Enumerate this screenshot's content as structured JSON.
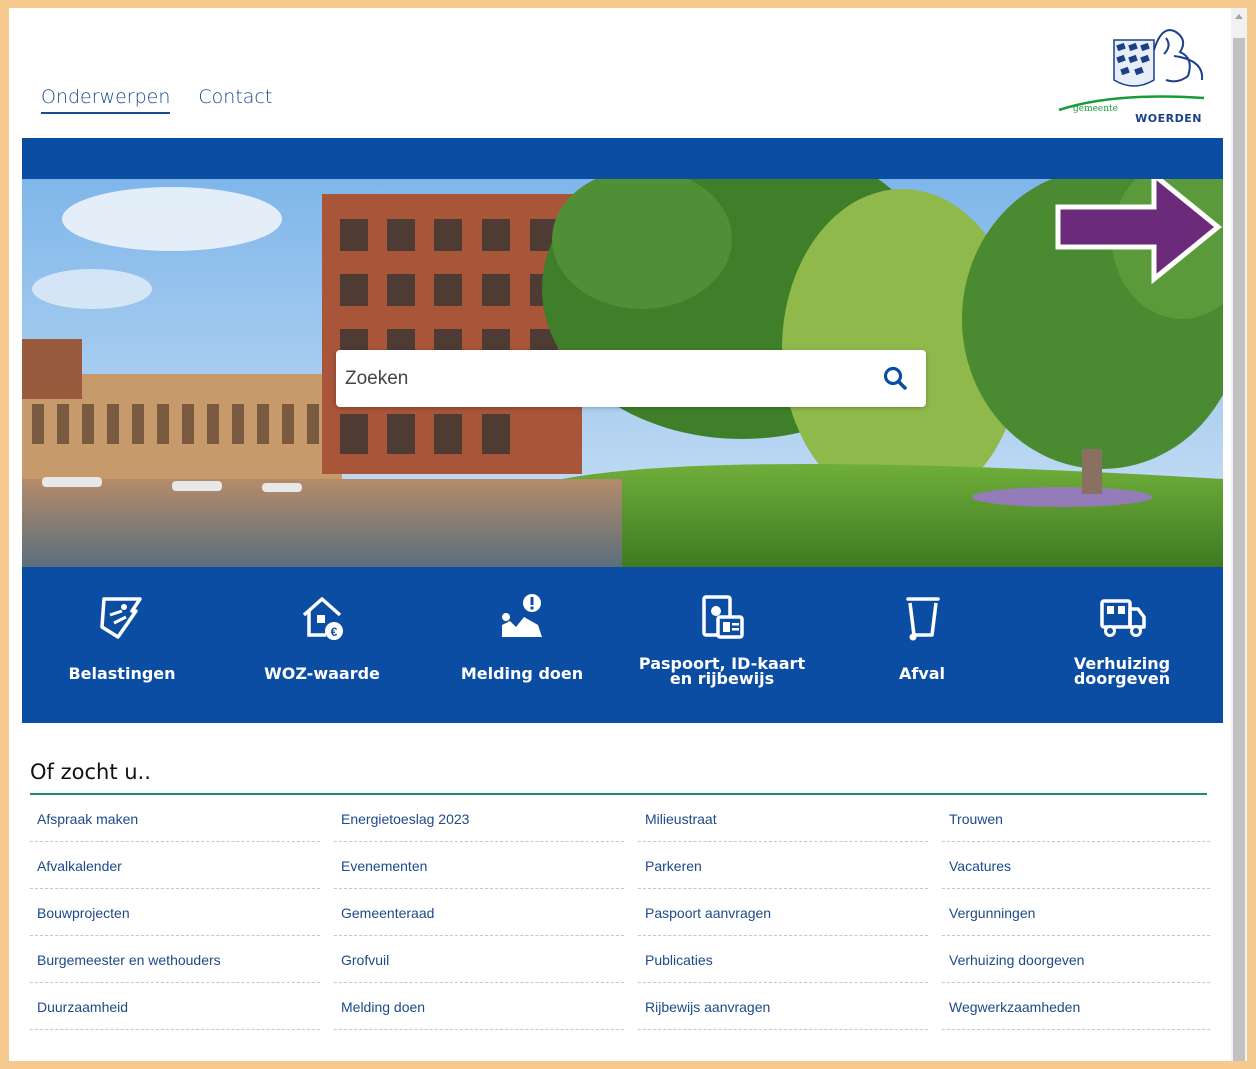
{
  "nav": {
    "items": [
      {
        "label": "Onderwerpen",
        "active": true
      },
      {
        "label": "Contact",
        "active": false
      }
    ]
  },
  "logo": {
    "line1": "gemeente",
    "line2": "WOERDEN"
  },
  "search": {
    "placeholder": "Zoeken",
    "value": ""
  },
  "quick_links": [
    {
      "label": "Belastingen",
      "icon": "tax-receipt-icon"
    },
    {
      "label": "WOZ-waarde",
      "icon": "house-euro-icon"
    },
    {
      "label": "Melding doen",
      "icon": "report-issue-icon"
    },
    {
      "label": "Paspoort, ID-kaart en rijbewijs",
      "line1": "Paspoort, ID-kaart",
      "line2": "en rijbewijs",
      "icon": "id-card-icon"
    },
    {
      "label": "Afval",
      "icon": "waste-bin-icon"
    },
    {
      "label": "Verhuizing doorgeven",
      "line1": "Verhuizing",
      "line2": "doorgeven",
      "icon": "moving-truck-icon"
    }
  ],
  "related": {
    "title": "Of zocht u..",
    "columns": [
      [
        "Afspraak maken",
        "Afvalkalender",
        "Bouwprojecten",
        "Burgemeester en wethouders",
        "Duurzaamheid"
      ],
      [
        "Energietoeslag 2023",
        "Evenementen",
        "Gemeenteraad",
        "Grofvuil",
        "Melding doen"
      ],
      [
        "Milieustraat",
        "Parkeren",
        "Paspoort aanvragen",
        "Publicaties",
        "Rijbewijs aanvragen"
      ],
      [
        "Trouwen",
        "Vacatures",
        "Vergunningen",
        "Verhuizing doorgeven",
        "Wegwerkzaamheden"
      ]
    ]
  },
  "colors": {
    "brand_blue": "#0b4da2",
    "link_blue": "#1c4a8a",
    "accent_green": "#1d8a6c",
    "annotation_arrow": "#6b2a7a"
  }
}
